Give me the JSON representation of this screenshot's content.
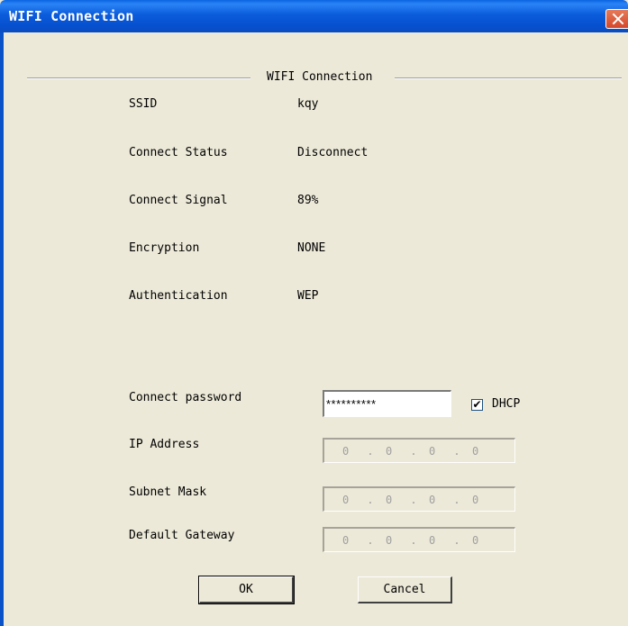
{
  "window": {
    "title": "WIFI Connection"
  },
  "group": {
    "title": "WIFI Connection"
  },
  "info": [
    {
      "label": "SSID",
      "value": "kqy"
    },
    {
      "label": "Connect Status",
      "value": "Disconnect"
    },
    {
      "label": "Connect Signal",
      "value": "89%"
    },
    {
      "label": "Encryption",
      "value": "NONE"
    },
    {
      "label": "Authentication",
      "value": "WEP"
    }
  ],
  "password": {
    "label": "Connect password",
    "value": "**********"
  },
  "dhcp": {
    "label": "DHCP",
    "checked": true,
    "check_glyph": "✔"
  },
  "network": [
    {
      "label": "IP Address",
      "octets": [
        "0",
        "0",
        "0",
        "0"
      ]
    },
    {
      "label": "Subnet Mask",
      "octets": [
        "0",
        "0",
        "0",
        "0"
      ]
    },
    {
      "label": "Default Gateway",
      "octets": [
        "0",
        "0",
        "0",
        "0"
      ]
    }
  ],
  "buttons": {
    "ok": "OK",
    "cancel": "Cancel"
  },
  "colors": {
    "titlebar": "#0b5cdb",
    "dialog_bg": "#ece9d8",
    "close": "#d5462a"
  },
  "icons": {
    "close": "close-icon"
  }
}
